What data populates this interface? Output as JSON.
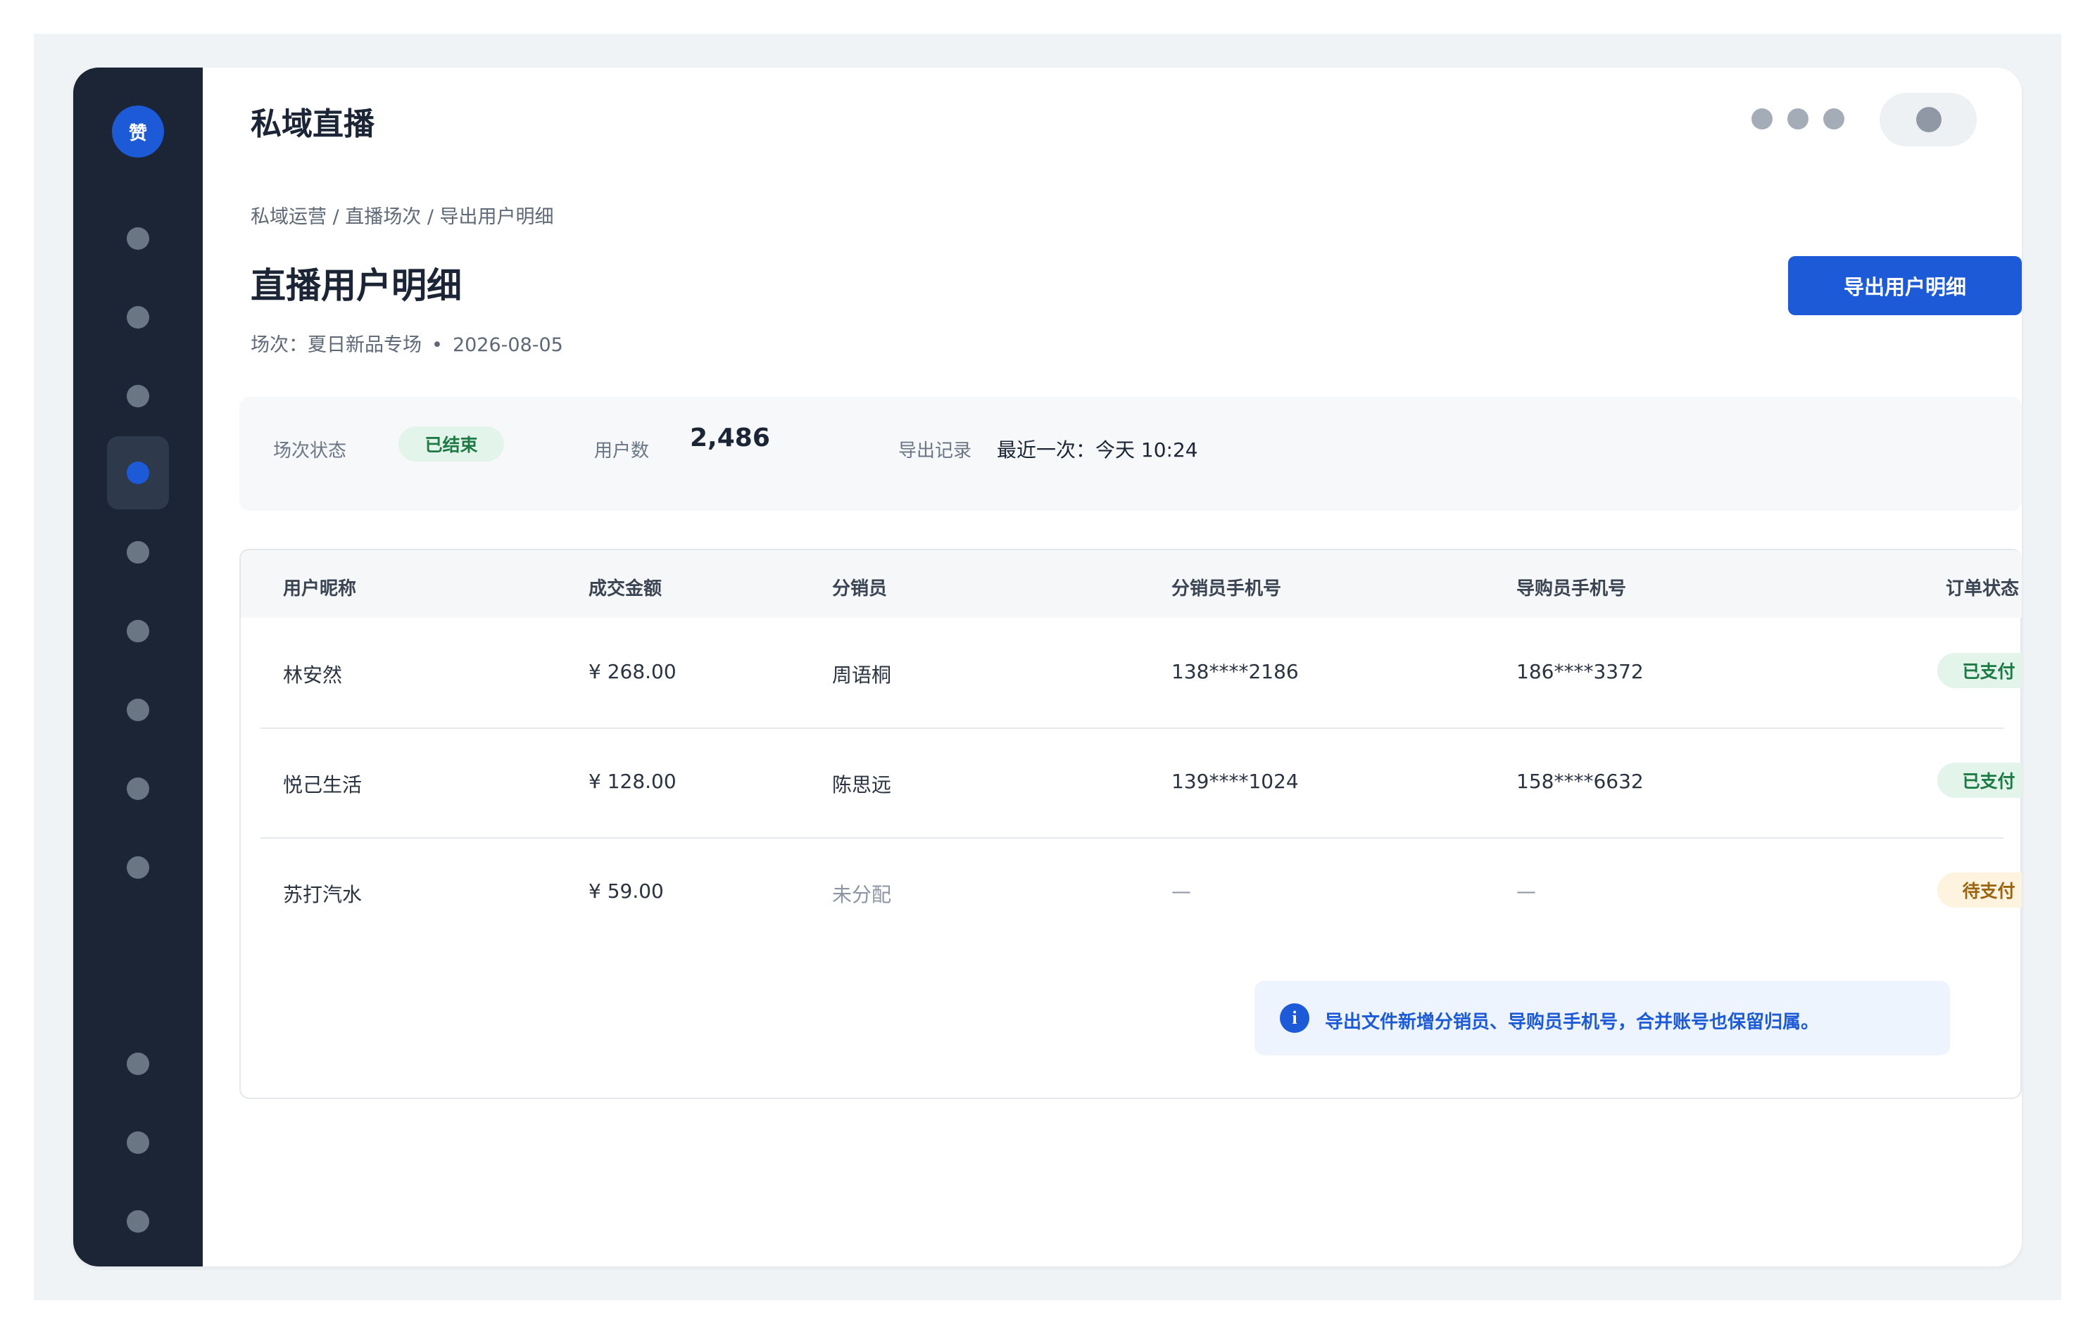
{
  "app": {
    "logo_text": "赞",
    "title": "私域直播"
  },
  "breadcrumb": "私域运营 / 直播场次 / 导出用户明细",
  "page": {
    "title": "直播用户明细",
    "session_prefix": "场次：",
    "session_name": "夏日新品专场",
    "session_separator": "•",
    "session_date": "2026-08-05"
  },
  "actions": {
    "export_label": "导出用户明细"
  },
  "summary": {
    "status_label": "场次状态",
    "status_value": "已结束",
    "users_label": "用户数",
    "users_value": "2,486",
    "export_label": "导出记录",
    "export_value": "最近一次：今天 10:24"
  },
  "table": {
    "headers": [
      "用户昵称",
      "成交金额",
      "分销员",
      "分销员手机号",
      "导购员手机号",
      "订单状态"
    ],
    "rows": [
      {
        "nickname": "林安然",
        "amount": "¥ 268.00",
        "distributor": "周语桐",
        "distributor_phone": "138****2186",
        "guide_phone": "186****3372",
        "status": "已支付"
      },
      {
        "nickname": "悦己生活",
        "amount": "¥ 128.00",
        "distributor": "陈思远",
        "distributor_phone": "139****1024",
        "guide_phone": "158****6632",
        "status": "已支付"
      },
      {
        "nickname": "苏打汽水",
        "amount": "¥ 59.00",
        "distributor": "未分配",
        "distributor_phone": "—",
        "guide_phone": "—",
        "status": "待支付"
      }
    ]
  },
  "notice": {
    "icon": "info-icon",
    "icon_glyph": "i",
    "text": "导出文件新增分销员、导购员手机号，合并账号也保留归属。"
  },
  "colors": {
    "accent": "#1d5ad8",
    "sidebar": "#1b2535",
    "status_paid": "#1e7a45",
    "status_pending": "#9a6410"
  }
}
